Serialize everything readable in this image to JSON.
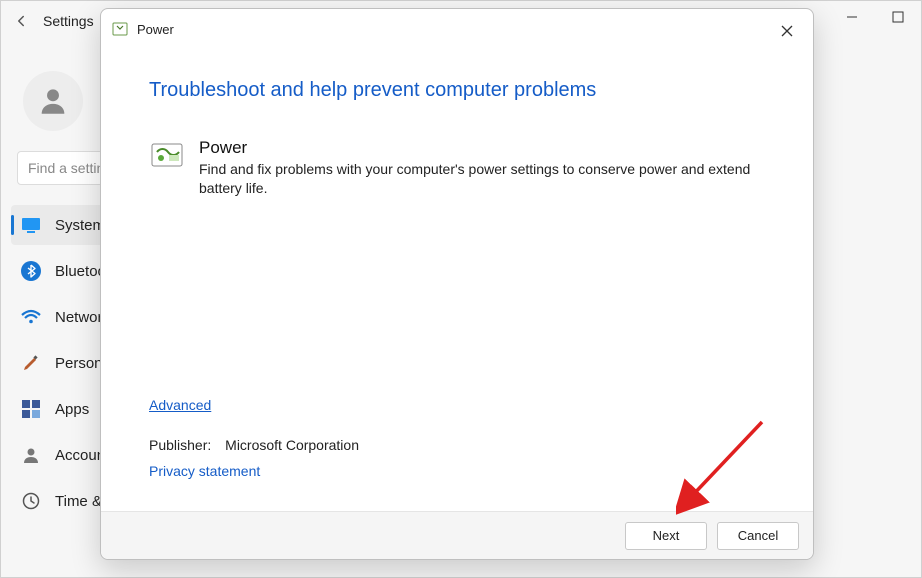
{
  "settings": {
    "title": "Settings",
    "search_placeholder": "Find a setting",
    "nav": [
      {
        "label": "System",
        "icon": "system-icon"
      },
      {
        "label": "Bluetooth",
        "icon": "bluetooth-icon"
      },
      {
        "label": "Network",
        "icon": "wifi-icon"
      },
      {
        "label": "Personalization",
        "icon": "brush-icon"
      },
      {
        "label": "Apps",
        "icon": "apps-icon"
      },
      {
        "label": "Accounts",
        "icon": "accounts-icon"
      },
      {
        "label": "Time & language",
        "icon": "time-icon"
      }
    ]
  },
  "dialog": {
    "window_title": "Power",
    "heading": "Troubleshoot and help prevent computer problems",
    "section_title": "Power",
    "section_desc": "Find and fix problems with your computer's power settings to conserve power and extend battery life.",
    "advanced_link": "Advanced",
    "publisher_label": "Publisher:",
    "publisher_value": "Microsoft Corporation",
    "privacy_link": "Privacy statement",
    "next_button": "Next",
    "cancel_button": "Cancel"
  }
}
